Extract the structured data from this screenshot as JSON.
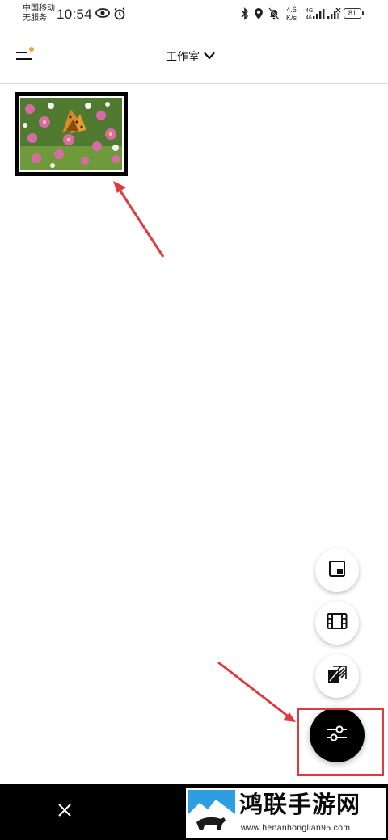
{
  "status_bar": {
    "carrier_line1": "中国移动",
    "carrier_line2": "无服务",
    "time": "10:54",
    "net_speed_value": "4.6",
    "net_speed_unit": "K/s",
    "signal_label_top": "4G",
    "signal_label_bottom": "46",
    "battery_level": "81",
    "icons": [
      "eye-icon",
      "alarm-icon",
      "bluetooth-icon",
      "location-icon",
      "mute-bell-icon",
      "signal-icon",
      "signal-no-service-icon",
      "battery-icon"
    ]
  },
  "app_bar": {
    "title": "工作室",
    "menu_icon": "menu-icon",
    "notification_dot_color": "#f2a33a",
    "dropdown_icon": "chevron-down-icon"
  },
  "gallery": {
    "items": [
      {
        "type": "image",
        "subject": "butterfly on pink flowers",
        "frame": "black-white-border"
      }
    ]
  },
  "fab_menu": {
    "actions": [
      {
        "icon": "layout-icon",
        "name": "layout"
      },
      {
        "icon": "film-icon",
        "name": "video"
      },
      {
        "icon": "stripes-icon",
        "name": "background"
      }
    ],
    "main_icon": "sliders-icon"
  },
  "bottom_bar": {
    "close_icon": "close-icon"
  },
  "annotations": {
    "arrow_color": "#e03a3e",
    "highlight_color": "#e03a3e"
  },
  "watermark": {
    "title": "鸿联手游网",
    "url": "www.henanhonglian95.com"
  }
}
